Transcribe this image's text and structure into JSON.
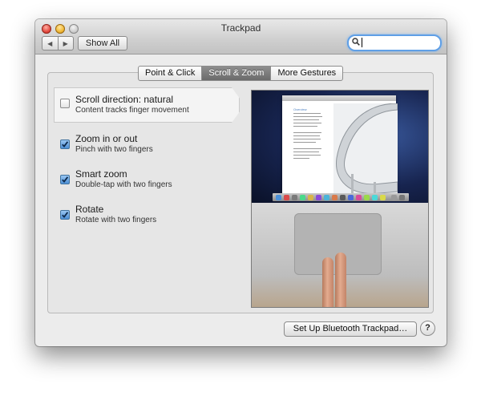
{
  "window": {
    "title": "Trackpad",
    "show_all_label": "Show All",
    "search": {
      "value": "",
      "placeholder": ""
    }
  },
  "tabs": [
    {
      "label": "Point & Click",
      "selected": false
    },
    {
      "label": "Scroll & Zoom",
      "selected": true
    },
    {
      "label": "More Gestures",
      "selected": false
    }
  ],
  "options": [
    {
      "title": "Scroll direction: natural",
      "subtitle": "Content tracks finger movement",
      "checked": false,
      "selected": true
    },
    {
      "title": "Zoom in or out",
      "subtitle": "Pinch with two fingers",
      "checked": true,
      "selected": false
    },
    {
      "title": "Smart zoom",
      "subtitle": "Double-tap with two fingers",
      "checked": true,
      "selected": false
    },
    {
      "title": "Rotate",
      "subtitle": "Rotate with two fingers",
      "checked": true,
      "selected": false
    }
  ],
  "preview": {
    "document_heading": "Overview"
  },
  "footer": {
    "setup_label": "Set Up Bluetooth Trackpad…",
    "help_label": "?"
  },
  "colors": {
    "accent": "#5f9fe6",
    "selected_tab": "#6b6b6b",
    "checkbox_checked": "#4d8fd5"
  },
  "icons": {
    "back": "triangle-left",
    "forward": "triangle-right",
    "search": "magnifier",
    "checkmark": "checkmark"
  }
}
